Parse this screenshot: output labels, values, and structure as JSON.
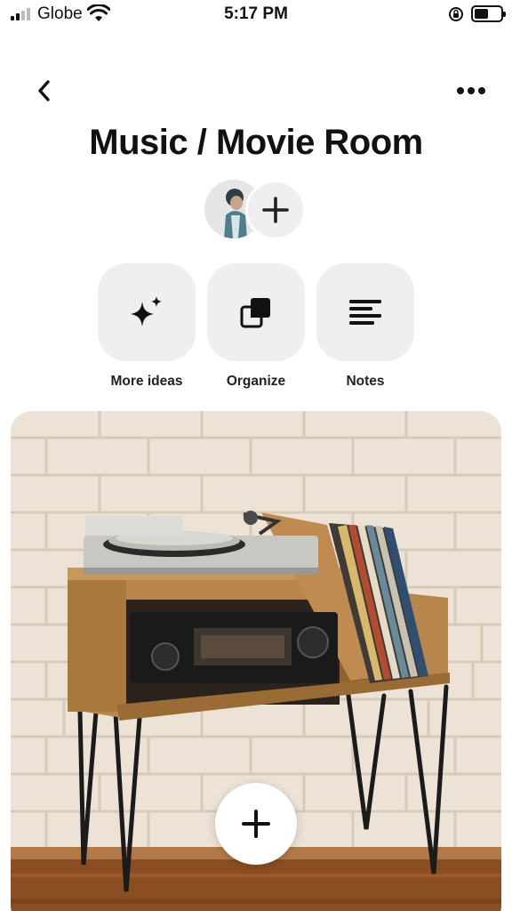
{
  "status_bar": {
    "carrier": "Globe",
    "time": "5:17 PM",
    "battery_level": 0.55
  },
  "header": {
    "back_icon": "chevron-left-icon",
    "more_icon": "more-horizontal-icon"
  },
  "board": {
    "title": "Music / Movie Room"
  },
  "collaborators": {
    "add_icon": "plus-icon"
  },
  "actions": [
    {
      "label": "More ideas",
      "icon": "sparkle-icon"
    },
    {
      "label": "Organize",
      "icon": "organize-icon"
    },
    {
      "label": "Notes",
      "icon": "notes-lines-icon"
    }
  ],
  "fab": {
    "icon": "plus-icon"
  },
  "colors": {
    "tile_bg": "#efefef",
    "text": "#111111",
    "brick": "#ece3d6",
    "wood": "#b8864d",
    "floor": "#8a4e22"
  }
}
